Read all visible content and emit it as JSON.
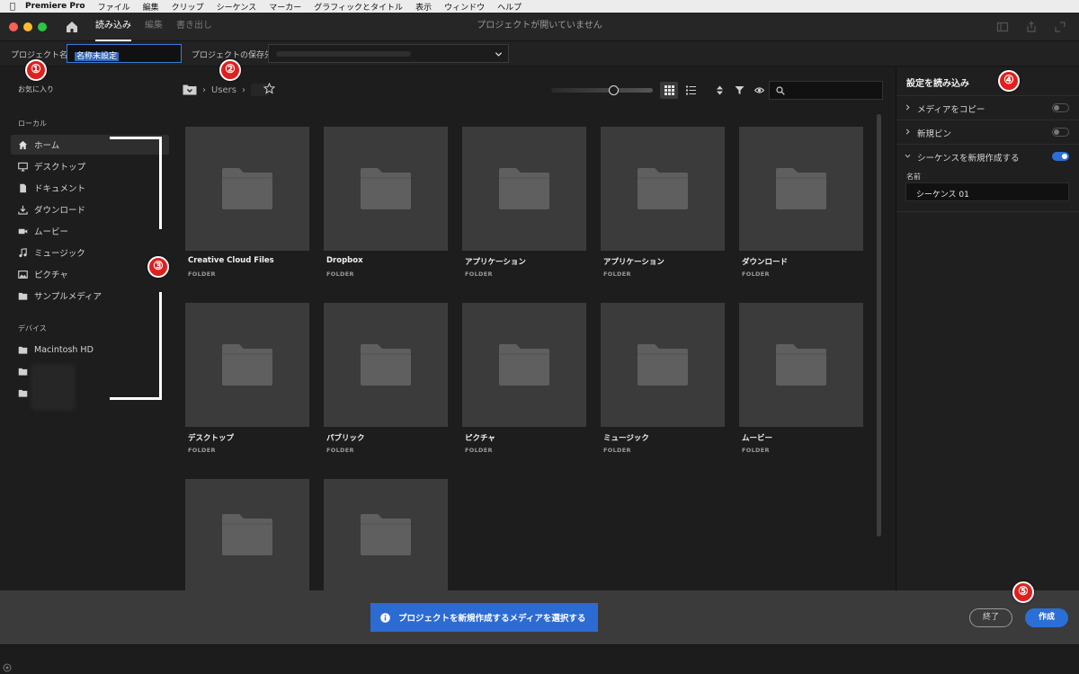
{
  "menubar": {
    "app": "Premiere Pro",
    "items": [
      "ファイル",
      "編集",
      "クリップ",
      "シーケンス",
      "マーカー",
      "グラフィックとタイトル",
      "表示",
      "ウィンドウ",
      "ヘルプ"
    ]
  },
  "window": {
    "title": "プロジェクトが開いていません",
    "tabs": [
      "読み込み",
      "編集",
      "書き出し"
    ]
  },
  "project": {
    "name_label": "プロジェクト名",
    "name_value": "名称未設定",
    "location_label": "プロジェクトの保存先"
  },
  "sidebar": {
    "favorites": "お気に入り",
    "local_header": "ローカル",
    "local_items": [
      "ホーム",
      "デスクトップ",
      "ドキュメント",
      "ダウンロード",
      "ムービー",
      "ミュージック",
      "ピクチャ",
      "サンプルメディア"
    ],
    "devices_header": "デバイス",
    "device_items": [
      "Macintosh HD"
    ]
  },
  "browser": {
    "breadcrumb": [
      "Users"
    ],
    "folders": [
      {
        "name": "Creative Cloud Files",
        "type": "FOLDER"
      },
      {
        "name": "Dropbox",
        "type": "FOLDER"
      },
      {
        "name": "アプリケーション",
        "type": "FOLDER"
      },
      {
        "name": "アプリケーション",
        "type": "FOLDER"
      },
      {
        "name": "ダウンロード",
        "type": "FOLDER"
      },
      {
        "name": "デスクトップ",
        "type": "FOLDER"
      },
      {
        "name": "パブリック",
        "type": "FOLDER"
      },
      {
        "name": "ピクチャ",
        "type": "FOLDER"
      },
      {
        "name": "ミュージック",
        "type": "FOLDER"
      },
      {
        "name": "ムービー",
        "type": "FOLDER"
      },
      {
        "name": "",
        "type": ""
      },
      {
        "name": "",
        "type": ""
      }
    ]
  },
  "settings": {
    "title": "設定を読み込み",
    "rows": [
      {
        "label": "メディアをコピー",
        "on": false
      },
      {
        "label": "新規ビン",
        "on": false
      },
      {
        "label": "シーケンスを新規作成する",
        "on": true
      }
    ],
    "name_label": "名前",
    "name_value": "シーケンス 01"
  },
  "footer": {
    "hint": "プロジェクトを新規作成するメディアを選択する",
    "exit_label": "終了",
    "create_label": "作成"
  },
  "markers": [
    "①",
    "②",
    "③",
    "④",
    "⑤"
  ],
  "colors": {
    "accent": "#2b6fd6",
    "marker": "#e01f1f",
    "tile": "#3b3b3b"
  }
}
